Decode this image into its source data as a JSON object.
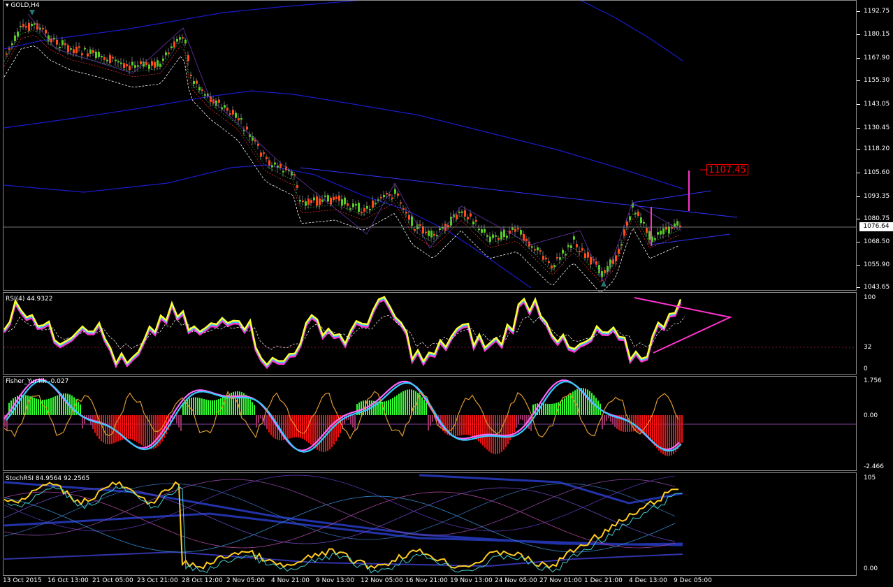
{
  "symbol": {
    "label": "GOLD,H4"
  },
  "panes": {
    "rsi": {
      "label": "RSI(4) 44.9322",
      "ticks": [
        "100",
        "32",
        "0"
      ]
    },
    "fisher": {
      "label": "Fisher_Yur4ik -0.027",
      "ticks": [
        "1.756",
        "0.00",
        "-2.466"
      ]
    },
    "stochrsi": {
      "label": "StochRSI 84.9564 92.2565",
      "ticks": [
        "105",
        "0.00"
      ]
    }
  },
  "price_axis": [
    "1192.75",
    "1180.15",
    "1167.90",
    "1155.30",
    "1143.05",
    "1130.45",
    "1118.20",
    "1105.60",
    "1093.35",
    "1080.75",
    "1068.50",
    "1055.90",
    "1043.65"
  ],
  "current_price": "1076.64",
  "alert_price": "1107.45",
  "time_axis": [
    "13 Oct 2015",
    "16 Oct 13:00",
    "21 Oct 05:00",
    "23 Oct 21:00",
    "28 Oct 12:00",
    "2 Nov 05:00",
    "4 Nov 21:00",
    "9 Nov 13:00",
    "12 Nov 05:00",
    "16 Nov 21:00",
    "19 Nov 13:00",
    "24 Nov 05:00",
    "27 Nov 01:00",
    "1 Dec 21:00",
    "4 Dec 13:00",
    "9 Dec 05:00"
  ],
  "colors": {
    "bull": "#55cc22",
    "bear": "#ff4a1a",
    "rsi": "#ffff33",
    "pink": "#ff33cc",
    "envelope": "#1a1acc",
    "trend": "#3333ff"
  }
}
